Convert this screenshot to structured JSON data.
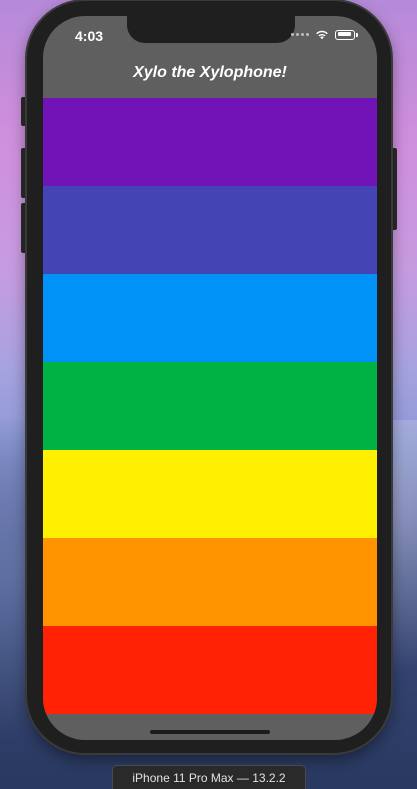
{
  "status_bar": {
    "time": "4:03"
  },
  "app_bar": {
    "title": "Xylo the Xylophone!"
  },
  "bars": [
    {
      "color": "#7213b8"
    },
    {
      "color": "#4444b4"
    },
    {
      "color": "#0092f7"
    },
    {
      "color": "#00b244"
    },
    {
      "color": "#fff002"
    },
    {
      "color": "#ff9300"
    },
    {
      "color": "#ff2205"
    }
  ],
  "simulator": {
    "device_label": "iPhone 11 Pro Max — 13.2.2"
  },
  "icons": {
    "wifi": "wifi-icon",
    "battery": "battery-icon",
    "signal": "cellular-signal-icon"
  }
}
